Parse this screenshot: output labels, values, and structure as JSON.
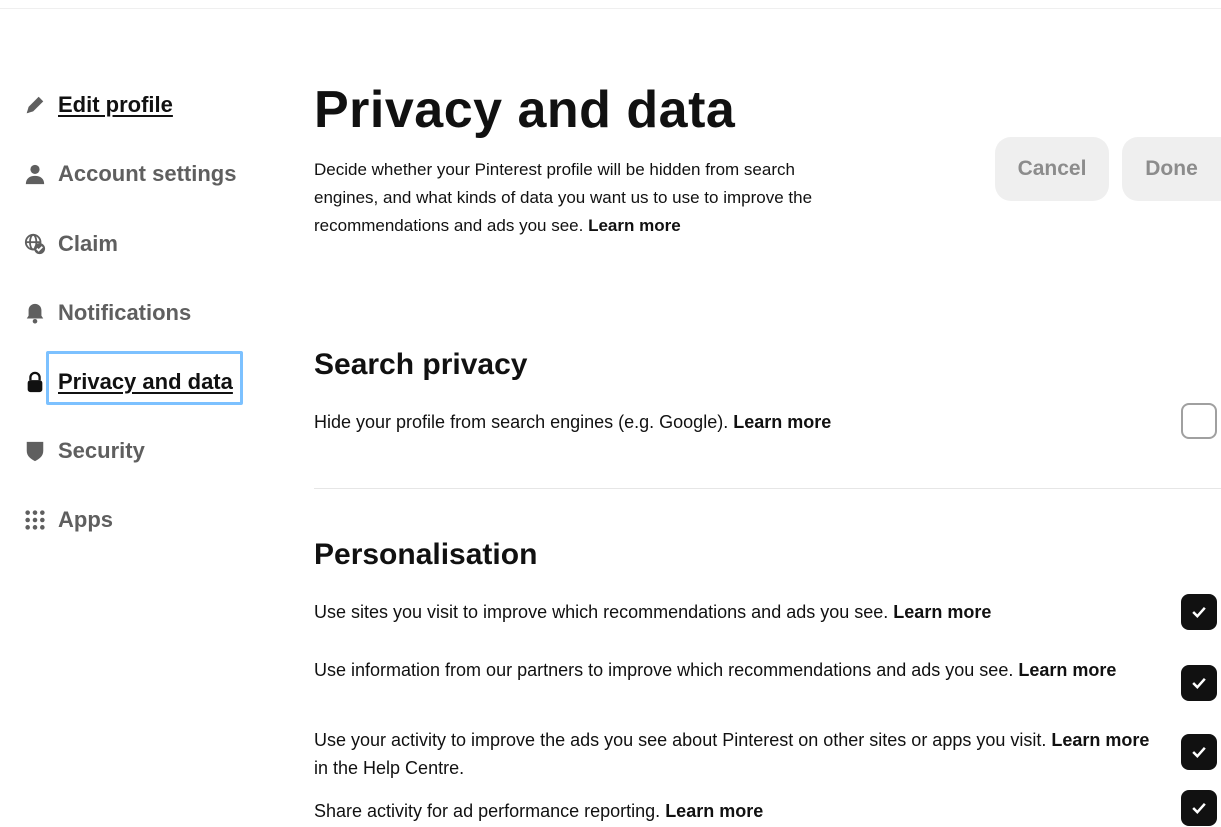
{
  "sidebar": {
    "items": [
      {
        "label": "Edit profile",
        "icon": "pencil-icon"
      },
      {
        "label": "Account settings",
        "icon": "person-icon"
      },
      {
        "label": "Claim",
        "icon": "globe-check-icon"
      },
      {
        "label": "Notifications",
        "icon": "bell-icon"
      },
      {
        "label": "Privacy and data",
        "icon": "lock-icon",
        "active": true
      },
      {
        "label": "Security",
        "icon": "shield-icon"
      },
      {
        "label": "Apps",
        "icon": "grid-icon"
      }
    ]
  },
  "main": {
    "title": "Privacy and data",
    "description": "Decide whether your Pinterest profile will be hidden from search engines, and what kinds of data you want us to use to improve the recommendations and ads you see.",
    "description_link": "Learn more",
    "buttons": {
      "cancel": "Cancel",
      "done": "Done"
    }
  },
  "search_privacy": {
    "title": "Search privacy",
    "options": [
      {
        "text": "Hide your profile from search engines (e.g. Google).",
        "link": "Learn more",
        "checked": false
      }
    ]
  },
  "personalisation": {
    "title": "Personalisation",
    "options": [
      {
        "text": "Use sites you visit to improve which recommendations and ads you see.",
        "link": "Learn more",
        "checked": true
      },
      {
        "text": "Use information from our partners to improve which recommendations and ads you see.",
        "link": "Learn more",
        "checked": true
      },
      {
        "text": "Use your activity to improve the ads you see about Pinterest on other sites or apps you visit.",
        "link": "Learn more",
        "suffix": "in the Help Centre.",
        "checked": true
      },
      {
        "text": "Share activity for ad performance reporting.",
        "link": "Learn more",
        "checked": true
      }
    ]
  },
  "colors": {
    "focus_ring": "#7cc1ff",
    "checkbox_checked": "#111111",
    "button_bg": "#efefef"
  }
}
